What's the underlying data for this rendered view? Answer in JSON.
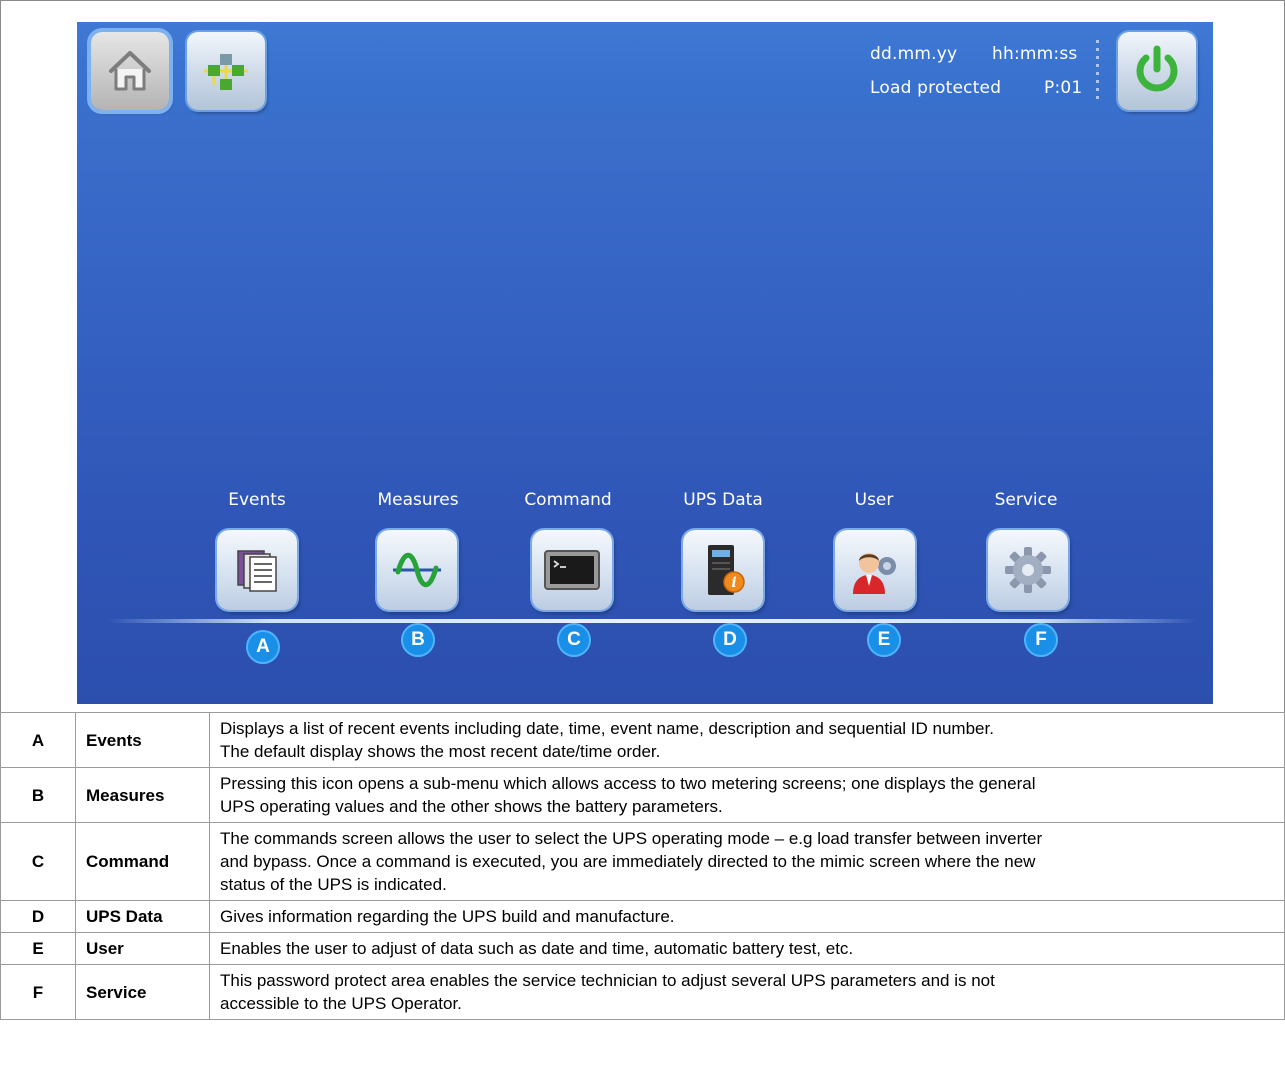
{
  "status": {
    "date": "dd.mm.yy",
    "time": "hh:mm:ss",
    "load_state": "Load protected",
    "page": "P:01"
  },
  "menu": [
    {
      "label": "Events",
      "badge": "A",
      "icon": "events-icon"
    },
    {
      "label": "Measures",
      "badge": "B",
      "icon": "measures-icon"
    },
    {
      "label": "Command",
      "badge": "C",
      "icon": "command-icon"
    },
    {
      "label": "UPS Data",
      "badge": "D",
      "icon": "ups-data-icon"
    },
    {
      "label": "User",
      "badge": "E",
      "icon": "user-icon"
    },
    {
      "label": "Service",
      "badge": "F",
      "icon": "service-icon"
    }
  ],
  "legend": [
    {
      "key": "A",
      "name": "Events",
      "lines": [
        "Displays a list of recent events including date, time, event name, description and sequential ID number.",
        "The default display shows the most recent date/time order."
      ]
    },
    {
      "key": "B",
      "name": "Measures",
      "lines": [
        "Pressing this icon opens a sub-menu which allows access to two metering screens; one displays the general",
        "UPS operating values and the other shows the battery parameters."
      ]
    },
    {
      "key": "C",
      "name": "Command",
      "lines": [
        "The commands screen allows the user to select the UPS operating mode – e.g load transfer between inverter",
        "and bypass. Once a command is executed, you are immediately directed to the mimic screen where the new",
        "status of the UPS is indicated."
      ]
    },
    {
      "key": "D",
      "name": "UPS Data",
      "lines": [
        "Gives information regarding the UPS build and manufacture."
      ]
    },
    {
      "key": "E",
      "name": "User",
      "lines": [
        "Enables the user to adjust of data such as date and time, automatic battery test, etc."
      ]
    },
    {
      "key": "F",
      "name": "Service",
      "lines": [
        "This password protect area enables the service technician to adjust several UPS parameters and is not",
        "accessible to the UPS Operator."
      ]
    }
  ],
  "colors": {
    "screen_blue": "#3563c4",
    "badge_blue": "#1a8fe8",
    "power_green": "#3cb43c"
  }
}
